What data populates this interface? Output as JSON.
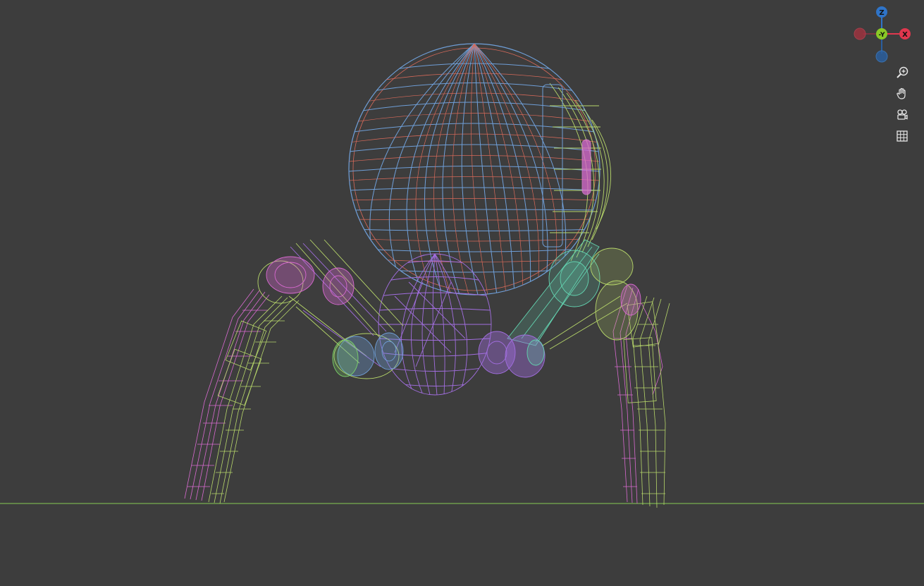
{
  "viewport": {
    "background": "#3d3d3d",
    "ground_line_color": "#7ab04f",
    "shading": "wireframe"
  },
  "gizmo": {
    "axes": [
      {
        "label": "Z",
        "color": "#2f74c8",
        "role": "up"
      },
      {
        "label": "-Y",
        "color": "#8ac926",
        "role": "center"
      },
      {
        "label": "X",
        "color": "#e0374e",
        "role": "right"
      },
      {
        "label": "",
        "color": "#a3323f",
        "role": "negative-x"
      },
      {
        "label": "",
        "color": "#2a5f9e",
        "role": "negative-z"
      }
    ]
  },
  "nav_buttons": [
    {
      "name": "zoom-button",
      "icon": "zoom-icon"
    },
    {
      "name": "pan-button",
      "icon": "hand-icon"
    },
    {
      "name": "camera-view-button",
      "icon": "camera-icon"
    },
    {
      "name": "ortho-toggle-button",
      "icon": "grid-icon"
    }
  ],
  "wire_colors": {
    "blue": "#6f9fd8",
    "red": "#d86a5a",
    "yellow_green": "#b7d76a",
    "purple": "#a26ee0",
    "pink": "#d86ad0",
    "teal": "#63d3b0",
    "green": "#7cd46a"
  }
}
